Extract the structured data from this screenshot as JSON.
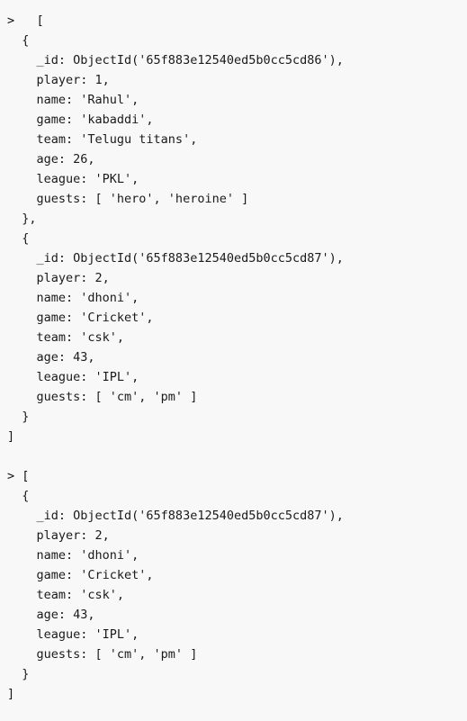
{
  "terminal": {
    "prompt_symbol": ">",
    "background_color": "#f8f8f8",
    "text_color": "#1a1a1a"
  },
  "blocks": [
    {
      "name": "first-query-output",
      "lines": [
        ">   [",
        "  {",
        "    _id: ObjectId('65f883e12540ed5b0cc5cd86'),",
        "    player: 1,",
        "    name: 'Rahul',",
        "    game: 'kabaddi',",
        "    team: 'Telugu titans',",
        "    age: 26,",
        "    league: 'PKL',",
        "    guests: [ 'hero', 'heroine' ]",
        "  },",
        "  {",
        "    _id: ObjectId('65f883e12540ed5b0cc5cd87'),",
        "    player: 2,",
        "    name: 'dhoni',",
        "    game: 'Cricket',",
        "    team: 'csk',",
        "    age: 43,",
        "    league: 'IPL',",
        "    guests: [ 'cm', 'pm' ]",
        "  }",
        "]"
      ]
    },
    {
      "name": "second-query-output",
      "lines": [
        "> [",
        "  {",
        "    _id: ObjectId('65f883e12540ed5b0cc5cd87'),",
        "    player: 2,",
        "    name: 'dhoni',",
        "    game: 'Cricket',",
        "    team: 'csk',",
        "    age: 43,",
        "    league: 'IPL',",
        "    guests: [ 'cm', 'pm' ]",
        "  }",
        "]"
      ]
    }
  ],
  "documents": [
    {
      "_id": "65f883e12540ed5b0cc5cd86",
      "player": 1,
      "name": "Rahul",
      "game": "kabaddi",
      "team": "Telugu titans",
      "age": 26,
      "league": "PKL",
      "guests": [
        "hero",
        "heroine"
      ]
    },
    {
      "_id": "65f883e12540ed5b0cc5cd87",
      "player": 2,
      "name": "dhoni",
      "game": "Cricket",
      "team": "csk",
      "age": 43,
      "league": "IPL",
      "guests": [
        "cm",
        "pm"
      ]
    }
  ]
}
